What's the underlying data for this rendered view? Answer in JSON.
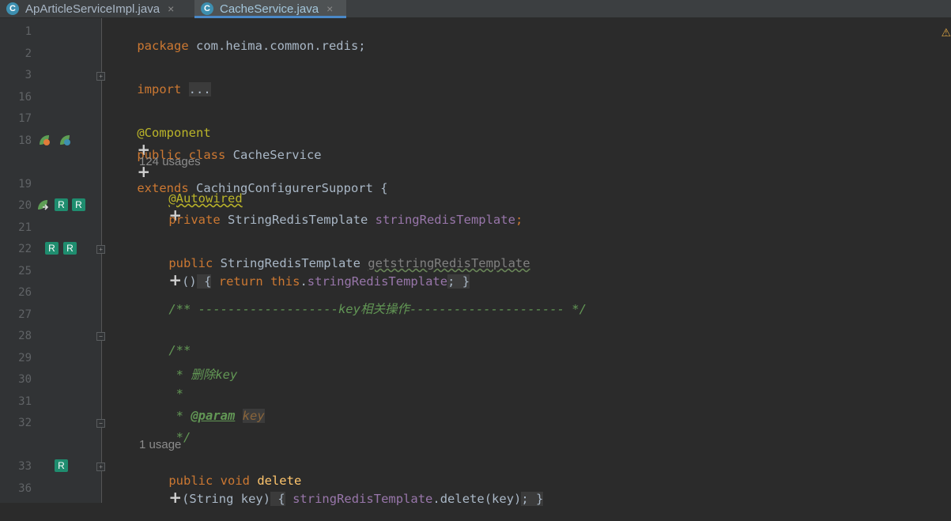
{
  "tabs": [
    {
      "icon": "class-icon",
      "label": "ApArticleServiceImpl.java",
      "close": "×",
      "active": false
    },
    {
      "icon": "class-icon",
      "label": "CacheService.java",
      "close": "×",
      "active": true
    }
  ],
  "gutter": {
    "line_numbers": [
      "1",
      "2",
      "3",
      "16",
      "17",
      "18",
      "19",
      "20",
      "21",
      "22",
      "25",
      "26",
      "27",
      "28",
      "29",
      "30",
      "31",
      "32",
      "33",
      "36"
    ],
    "markers": {
      "r": "R"
    }
  },
  "code": {
    "l1": {
      "kw": "package",
      "rest": " com.heima.common.redis;"
    },
    "l3": {
      "kw": "import",
      "fold": "..."
    },
    "l17": {
      "ann": "@Component"
    },
    "l18": {
      "kw1": "public class",
      "name": " CacheService",
      "kw2": "extends",
      "rest": " CachingConfigurerSupport {"
    },
    "usages1": "124 usages",
    "l19": {
      "ann": "@Autowired"
    },
    "l20": {
      "kw": "private",
      "type": " StringRedisTemplate ",
      "field": "stringRedisTemplate",
      "semi": ";"
    },
    "l22": {
      "kw": "public",
      "type": " StringRedisTemplate ",
      "method": "getstringRedisTemplate",
      "paren": "()",
      "open": " {",
      "kw_ret": " return",
      "kw_this": " this",
      "dot": ".",
      "field": "stringRedisTemplate",
      "semi": ";",
      "close": " }"
    },
    "l26": {
      "comment": "/** -------------------key相关操作--------------------- */"
    },
    "l28": {
      "comment": "/**"
    },
    "l29": {
      "comment": " * 删除key"
    },
    "l30": {
      "comment": " *"
    },
    "l31": {
      "prefix": " * ",
      "tag": "@param",
      "space": " ",
      "param": "key"
    },
    "l32": {
      "comment": " */"
    },
    "usages2": "1 usage",
    "l33": {
      "kw": "public void",
      "method": " delete",
      "args": "(String key)",
      "open": " {",
      "field": " stringRedisTemplate",
      "call": ".delete(key)",
      "semi": ";",
      "close": " }"
    }
  },
  "plus_glyph": "+",
  "warning_glyph": "⚠"
}
